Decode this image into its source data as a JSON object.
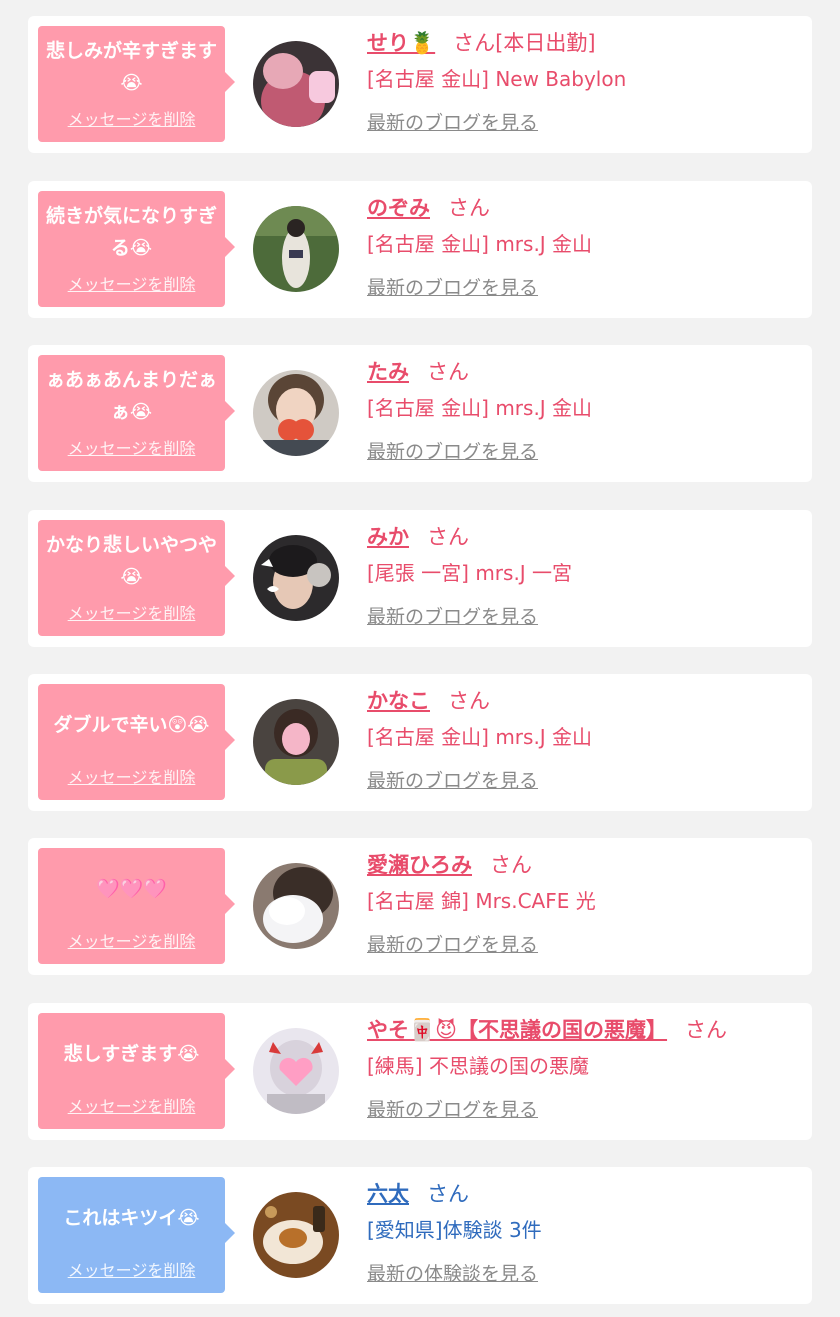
{
  "colors": {
    "card_bg": "#ffffff",
    "page_bg": "#f2f2f2",
    "bubble_pink": "#ff9bac",
    "bubble_blue": "#8cb8f4",
    "text_pink": "#e84c6b",
    "text_blue": "#2f6bbd",
    "link_gray": "#8a8a8a"
  },
  "entries": [
    {
      "message": "悲しみが辛すぎます😭",
      "delete_label": "メッセージを削除",
      "name": "せり🍍",
      "suffix": "さん[本日出勤]",
      "shop": "[名古屋 金山] New Babylon",
      "blog_link": "最新のブログを見る",
      "variant": "pink"
    },
    {
      "message": "続きが気になりすぎる😭",
      "delete_label": "メッセージを削除",
      "name": "のぞみ",
      "suffix": "さん",
      "shop": "[名古屋 金山] mrs.J 金山",
      "blog_link": "最新のブログを見る",
      "variant": "pink"
    },
    {
      "message": "ぁあぁあんまりだぁぁ😭",
      "delete_label": "メッセージを削除",
      "name": "たみ",
      "suffix": "さん",
      "shop": "[名古屋 金山] mrs.J 金山",
      "blog_link": "最新のブログを見る",
      "variant": "pink"
    },
    {
      "message": "かなり悲しいやつや😭",
      "delete_label": "メッセージを削除",
      "name": "みか",
      "suffix": "さん",
      "shop": "[尾張 一宮] mrs.J 一宮",
      "blog_link": "最新のブログを見る",
      "variant": "pink"
    },
    {
      "message": "ダブルで辛い😲😭",
      "delete_label": "メッセージを削除",
      "name": "かなこ",
      "suffix": "さん",
      "shop": "[名古屋 金山] mrs.J 金山",
      "blog_link": "最新のブログを見る",
      "variant": "pink"
    },
    {
      "message": "🩷🩷🩷",
      "delete_label": "メッセージを削除",
      "name": "愛瀬ひろみ",
      "suffix": "さん",
      "shop": "[名古屋 錦] Mrs.CAFE 光",
      "blog_link": "最新のブログを見る",
      "variant": "pink"
    },
    {
      "message": "悲しすぎます😭",
      "delete_label": "メッセージを削除",
      "name": "やそ🀄😈【不思議の国の悪魔】",
      "suffix": "さん",
      "shop": "[練馬] 不思議の国の悪魔",
      "blog_link": "最新のブログを見る",
      "variant": "pink"
    },
    {
      "message": "これはキツイ😭",
      "delete_label": "メッセージを削除",
      "name": "六太",
      "suffix": "さん",
      "shop": "[愛知県]体験談 3件",
      "blog_link": "最新の体験談を見る",
      "variant": "blue"
    }
  ]
}
